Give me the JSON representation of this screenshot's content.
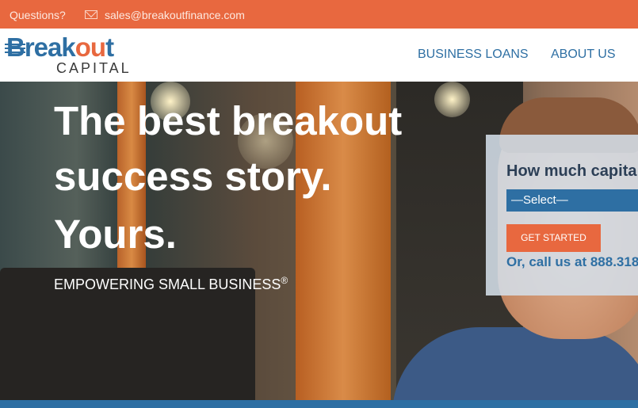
{
  "topbar": {
    "questions_label": "Questions?",
    "email": "sales@breakoutfinance.com",
    "background": "#e8683f"
  },
  "header": {
    "logo_main": "Breakout",
    "logo_sub": "CAPITAL",
    "nav": [
      {
        "label": "BUSINESS LOANS"
      },
      {
        "label": "ABOUT US"
      }
    ]
  },
  "hero": {
    "headline_line1": "The best breakout",
    "headline_line2": "success story.",
    "headline_line3": "Yours.",
    "tagline": "EMPOWERING SMALL BUSINESS",
    "tagline_mark": "®"
  },
  "form": {
    "question": "How much capita",
    "select_value": "—Select—",
    "button_label": "GET STARTED",
    "call_text": "Or, call us at 888.318"
  },
  "colors": {
    "accent": "#e8683f",
    "brand_blue": "#2e6fa3"
  }
}
